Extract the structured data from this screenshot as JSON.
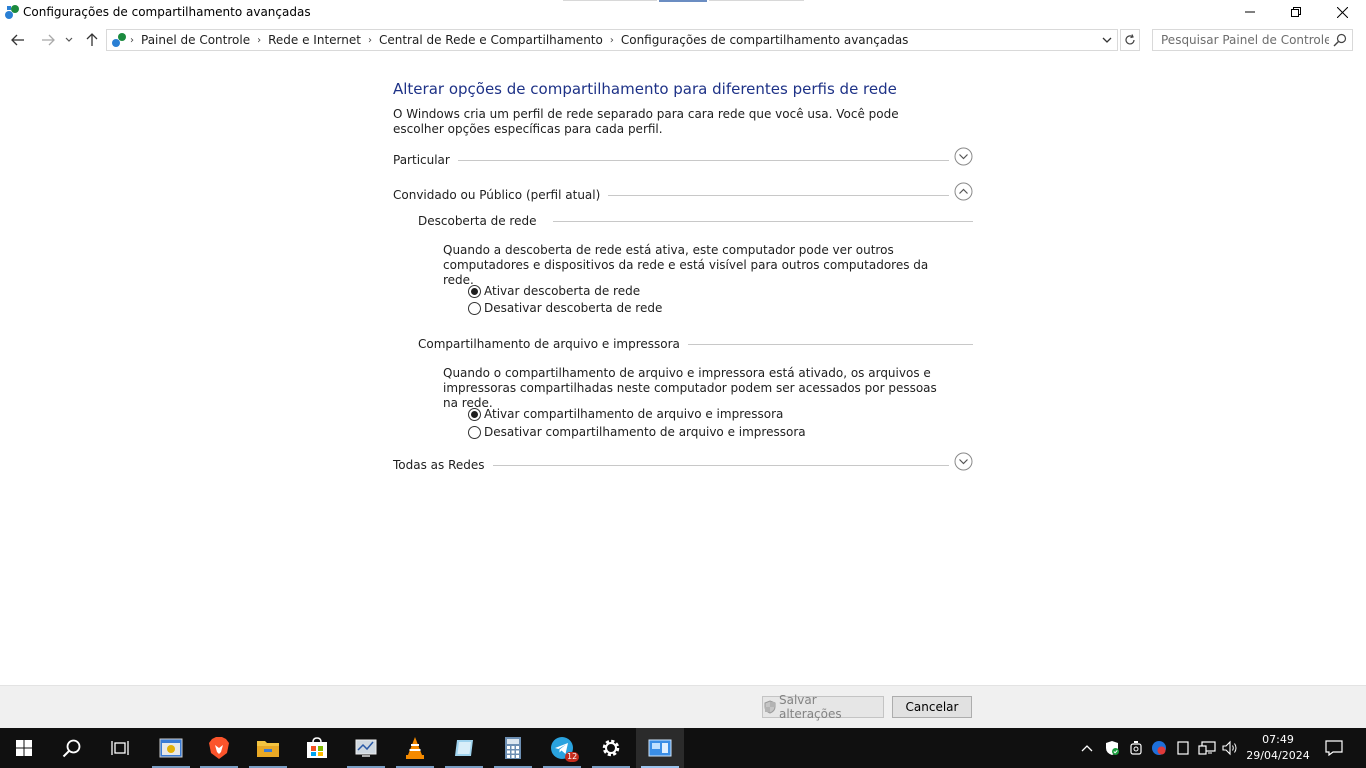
{
  "window": {
    "title": "Configurações de compartilhamento avançadas",
    "buttons": {
      "minimize": "minimize",
      "restore": "restore",
      "close": "close"
    }
  },
  "nav": {
    "breadcrumbs": [
      "Painel de Controle",
      "Rede e Internet",
      "Central de Rede e Compartilhamento",
      "Configurações de compartilhamento avançadas"
    ],
    "search_placeholder": "Pesquisar Painel de Controle"
  },
  "main": {
    "heading": "Alterar opções de compartilhamento para diferentes perfis de rede",
    "intro": "O Windows cria um perfil de rede separado para cara rede que você usa. Você pode escolher opções específicas para cada perfil.",
    "profiles": [
      {
        "label": "Particular",
        "expanded": false
      },
      {
        "label": "Convidado ou Público (perfil atual)",
        "expanded": true
      },
      {
        "label": "Todas as Redes",
        "expanded": false
      }
    ],
    "discovery": {
      "title": "Descoberta de rede",
      "description": "Quando a descoberta de rede está ativa, este computador pode ver outros computadores e dispositivos da rede e está visível para outros computadores da rede.",
      "on_label": "Ativar descoberta de rede",
      "off_label": "Desativar descoberta de rede",
      "selected": "on"
    },
    "sharing": {
      "title": "Compartilhamento de arquivo e impressora",
      "description": "Quando o compartilhamento de arquivo e impressora está ativado, os arquivos e impressoras compartilhadas neste computador podem ser acessados por pessoas na rede.",
      "on_label": "Ativar compartilhamento de arquivo e impressora",
      "off_label": "Desativar compartilhamento de arquivo e impressora",
      "selected": "on"
    }
  },
  "footer": {
    "save_label": "Salvar alterações",
    "cancel_label": "Cancelar"
  },
  "taskbar": {
    "apps": [
      "start-icon",
      "search-icon",
      "task-view-icon",
      "file-manager-app-icon",
      "brave-browser-icon",
      "file-explorer-icon",
      "microsoft-store-icon",
      "monitor-app-icon",
      "vlc-icon",
      "notepad-app-icon",
      "calculator-icon",
      "telegram-icon",
      "settings-icon",
      "control-panel-icon"
    ],
    "telegram_badge": "12",
    "time": "07:49",
    "date": "29/04/2024"
  },
  "colors": {
    "heading": "#1e3287",
    "taskbar": "#101010",
    "footer": "#f0f0f0"
  }
}
